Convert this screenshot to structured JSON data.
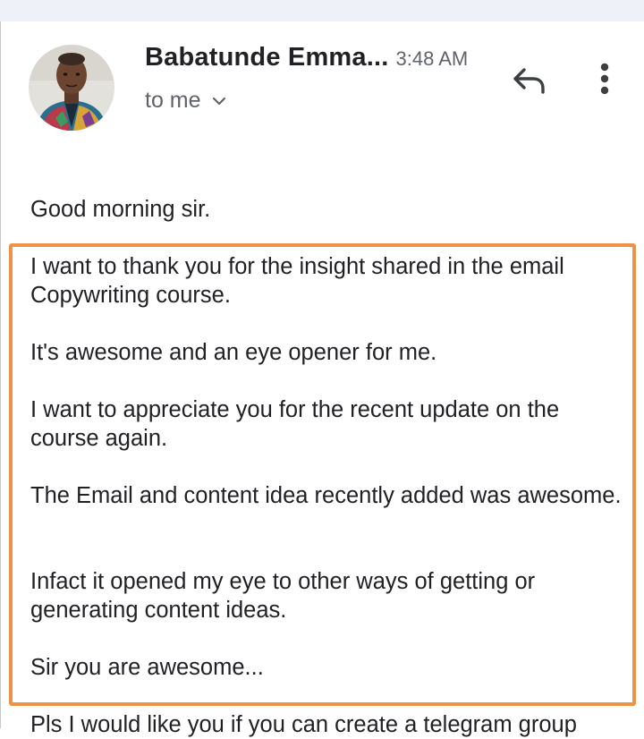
{
  "email": {
    "sender_name": "Babatunde Emma...",
    "time": "3:48 AM",
    "recipient": "to me",
    "icons": {
      "reply": "reply-icon",
      "more": "more-vert-icon",
      "expand": "chevron-down-icon"
    }
  },
  "body": {
    "greeting": "Good morning sir.",
    "highlighted_paragraphs": [
      "I want to thank you for the insight shared in the email Copywriting course.",
      "It's awesome and an eye opener for me.",
      "I want to appreciate you for the recent update on the course again.",
      "The  Email and content idea recently added was awesome.",
      "Infact it opened my eye to other ways of getting or generating content ideas.",
      "Sir you are awesome..."
    ],
    "trailing_text": "Pls I would like you if you can create a telegram group"
  },
  "colors": {
    "highlight_border": "#ee9345",
    "top_band": "#eef1f7",
    "text_primary": "#202124",
    "text_secondary": "#5f6368"
  }
}
